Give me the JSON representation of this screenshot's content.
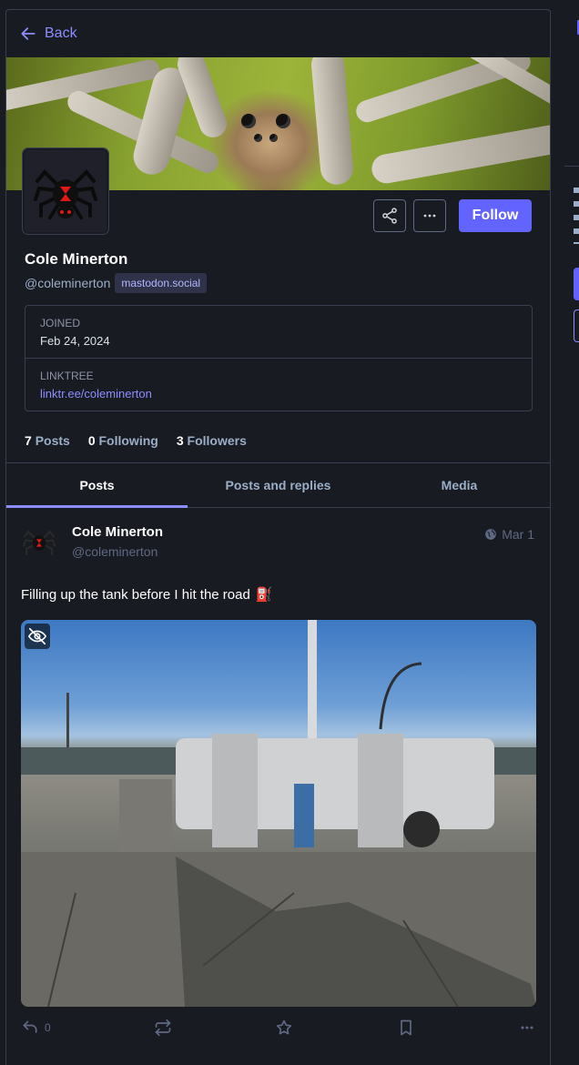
{
  "nav": {
    "back_label": "Back"
  },
  "profile": {
    "display_name": "Cole Minerton",
    "acct": "@coleminerton",
    "domain": "mastodon.social",
    "follow_label": "Follow",
    "fields": [
      {
        "name": "Joined",
        "value": "Feb 24, 2024"
      },
      {
        "name": "Linktree",
        "value": "linktr.ee/coleminerton"
      }
    ],
    "counts": {
      "posts": "7",
      "posts_label": "Posts",
      "following": "0",
      "following_label": "Following",
      "followers": "3",
      "followers_label": "Followers"
    }
  },
  "tabs": [
    "Posts",
    "Posts and replies",
    "Media"
  ],
  "status": {
    "display_name": "Cole Minerton",
    "acct": "@coleminerton",
    "time": "Mar 1",
    "text": "Filling up the tank before I hit the road",
    "emoji": "⛽",
    "reply_count": "0"
  },
  "colors": {
    "accent": "#6364ff",
    "link": "#8c8dff",
    "bg": "#191b22",
    "border": "#393f4f"
  }
}
